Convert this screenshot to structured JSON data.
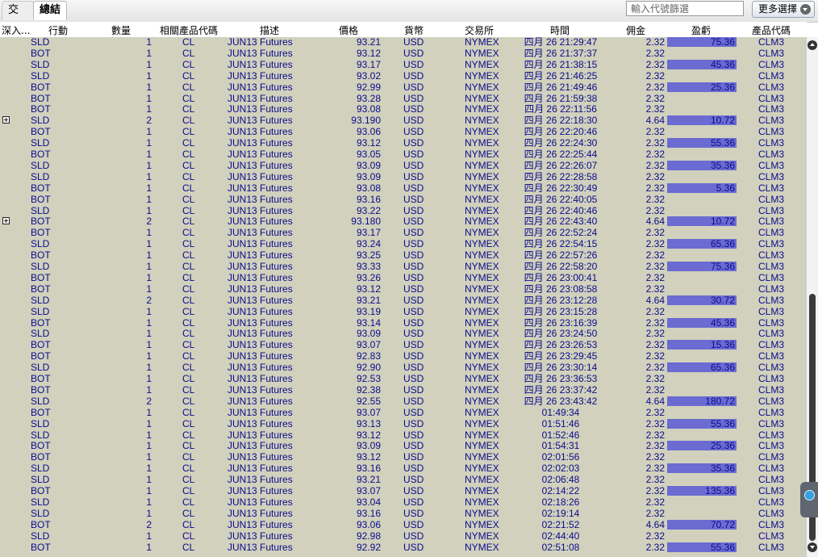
{
  "tabs": [
    "交易",
    "總結"
  ],
  "filter": {
    "placeholder": "輸入代號篩選"
  },
  "more_button": {
    "label": "更多選擇"
  },
  "columns": [
    "深入...",
    "行動",
    "數量",
    "相關產品代碼",
    "描述",
    "價格",
    "貨幣",
    "交易所",
    "時間",
    "佣金",
    "盈虧",
    "產品代碼"
  ],
  "colors": {
    "grid_background": "#d1d1bd",
    "row_text": "#0b0b8c",
    "pnl_bar": "#6b6bd2"
  },
  "rows": [
    {
      "expand": false,
      "action": "SLD",
      "qty": "1",
      "underlying": "CL",
      "desc": "JUN13 Futures",
      "price": "93.21",
      "currency": "USD",
      "exchange": "NYMEX",
      "time": "四月 26 21:29:47",
      "commission": "2.32",
      "pnl": "75.36",
      "symbol": "CLM3"
    },
    {
      "expand": false,
      "action": "BOT",
      "qty": "1",
      "underlying": "CL",
      "desc": "JUN13 Futures",
      "price": "93.12",
      "currency": "USD",
      "exchange": "NYMEX",
      "time": "四月 26 21:37:37",
      "commission": "2.32",
      "pnl": "",
      "symbol": "CLM3"
    },
    {
      "expand": false,
      "action": "SLD",
      "qty": "1",
      "underlying": "CL",
      "desc": "JUN13 Futures",
      "price": "93.17",
      "currency": "USD",
      "exchange": "NYMEX",
      "time": "四月 26 21:38:15",
      "commission": "2.32",
      "pnl": "45.36",
      "symbol": "CLM3"
    },
    {
      "expand": false,
      "action": "SLD",
      "qty": "1",
      "underlying": "CL",
      "desc": "JUN13 Futures",
      "price": "93.02",
      "currency": "USD",
      "exchange": "NYMEX",
      "time": "四月 26 21:46:25",
      "commission": "2.32",
      "pnl": "",
      "symbol": "CLM3"
    },
    {
      "expand": false,
      "action": "BOT",
      "qty": "1",
      "underlying": "CL",
      "desc": "JUN13 Futures",
      "price": "92.99",
      "currency": "USD",
      "exchange": "NYMEX",
      "time": "四月 26 21:49:46",
      "commission": "2.32",
      "pnl": "25.36",
      "symbol": "CLM3"
    },
    {
      "expand": false,
      "action": "BOT",
      "qty": "1",
      "underlying": "CL",
      "desc": "JUN13 Futures",
      "price": "93.28",
      "currency": "USD",
      "exchange": "NYMEX",
      "time": "四月 26 21:59:38",
      "commission": "2.32",
      "pnl": "",
      "symbol": "CLM3"
    },
    {
      "expand": false,
      "action": "BOT",
      "qty": "1",
      "underlying": "CL",
      "desc": "JUN13 Futures",
      "price": "93.08",
      "currency": "USD",
      "exchange": "NYMEX",
      "time": "四月 26 22:11:56",
      "commission": "2.32",
      "pnl": "",
      "symbol": "CLM3"
    },
    {
      "expand": true,
      "action": "SLD",
      "qty": "2",
      "underlying": "CL",
      "desc": "JUN13 Futures",
      "price": "93.190",
      "currency": "USD",
      "exchange": "NYMEX",
      "time": "四月 26 22:18:30",
      "commission": "4.64",
      "pnl": "10.72",
      "symbol": "CLM3"
    },
    {
      "expand": false,
      "action": "BOT",
      "qty": "1",
      "underlying": "CL",
      "desc": "JUN13 Futures",
      "price": "93.06",
      "currency": "USD",
      "exchange": "NYMEX",
      "time": "四月 26 22:20:46",
      "commission": "2.32",
      "pnl": "",
      "symbol": "CLM3"
    },
    {
      "expand": false,
      "action": "SLD",
      "qty": "1",
      "underlying": "CL",
      "desc": "JUN13 Futures",
      "price": "93.12",
      "currency": "USD",
      "exchange": "NYMEX",
      "time": "四月 26 22:24:30",
      "commission": "2.32",
      "pnl": "55.36",
      "symbol": "CLM3"
    },
    {
      "expand": false,
      "action": "BOT",
      "qty": "1",
      "underlying": "CL",
      "desc": "JUN13 Futures",
      "price": "93.05",
      "currency": "USD",
      "exchange": "NYMEX",
      "time": "四月 26 22:25:44",
      "commission": "2.32",
      "pnl": "",
      "symbol": "CLM3"
    },
    {
      "expand": false,
      "action": "SLD",
      "qty": "1",
      "underlying": "CL",
      "desc": "JUN13 Futures",
      "price": "93.09",
      "currency": "USD",
      "exchange": "NYMEX",
      "time": "四月 26 22:26:07",
      "commission": "2.32",
      "pnl": "35.36",
      "symbol": "CLM3"
    },
    {
      "expand": false,
      "action": "SLD",
      "qty": "1",
      "underlying": "CL",
      "desc": "JUN13 Futures",
      "price": "93.09",
      "currency": "USD",
      "exchange": "NYMEX",
      "time": "四月 26 22:28:58",
      "commission": "2.32",
      "pnl": "",
      "symbol": "CLM3"
    },
    {
      "expand": false,
      "action": "BOT",
      "qty": "1",
      "underlying": "CL",
      "desc": "JUN13 Futures",
      "price": "93.08",
      "currency": "USD",
      "exchange": "NYMEX",
      "time": "四月 26 22:30:49",
      "commission": "2.32",
      "pnl": "5.36",
      "symbol": "CLM3"
    },
    {
      "expand": false,
      "action": "BOT",
      "qty": "1",
      "underlying": "CL",
      "desc": "JUN13 Futures",
      "price": "93.16",
      "currency": "USD",
      "exchange": "NYMEX",
      "time": "四月 26 22:40:05",
      "commission": "2.32",
      "pnl": "",
      "symbol": "CLM3"
    },
    {
      "expand": false,
      "action": "SLD",
      "qty": "1",
      "underlying": "CL",
      "desc": "JUN13 Futures",
      "price": "93.22",
      "currency": "USD",
      "exchange": "NYMEX",
      "time": "四月 26 22:40:46",
      "commission": "2.32",
      "pnl": "",
      "symbol": "CLM3"
    },
    {
      "expand": true,
      "action": "BOT",
      "qty": "2",
      "underlying": "CL",
      "desc": "JUN13 Futures",
      "price": "93.180",
      "currency": "USD",
      "exchange": "NYMEX",
      "time": "四月 26 22:43:40",
      "commission": "4.64",
      "pnl": "10.72",
      "symbol": "CLM3"
    },
    {
      "expand": false,
      "action": "BOT",
      "qty": "1",
      "underlying": "CL",
      "desc": "JUN13 Futures",
      "price": "93.17",
      "currency": "USD",
      "exchange": "NYMEX",
      "time": "四月 26 22:52:24",
      "commission": "2.32",
      "pnl": "",
      "symbol": "CLM3"
    },
    {
      "expand": false,
      "action": "SLD",
      "qty": "1",
      "underlying": "CL",
      "desc": "JUN13 Futures",
      "price": "93.24",
      "currency": "USD",
      "exchange": "NYMEX",
      "time": "四月 26 22:54:15",
      "commission": "2.32",
      "pnl": "65.36",
      "symbol": "CLM3"
    },
    {
      "expand": false,
      "action": "BOT",
      "qty": "1",
      "underlying": "CL",
      "desc": "JUN13 Futures",
      "price": "93.25",
      "currency": "USD",
      "exchange": "NYMEX",
      "time": "四月 26 22:57:26",
      "commission": "2.32",
      "pnl": "",
      "symbol": "CLM3"
    },
    {
      "expand": false,
      "action": "SLD",
      "qty": "1",
      "underlying": "CL",
      "desc": "JUN13 Futures",
      "price": "93.33",
      "currency": "USD",
      "exchange": "NYMEX",
      "time": "四月 26 22:58:20",
      "commission": "2.32",
      "pnl": "75.36",
      "symbol": "CLM3"
    },
    {
      "expand": false,
      "action": "BOT",
      "qty": "1",
      "underlying": "CL",
      "desc": "JUN13 Futures",
      "price": "93.26",
      "currency": "USD",
      "exchange": "NYMEX",
      "time": "四月 26 23:00:41",
      "commission": "2.32",
      "pnl": "",
      "symbol": "CLM3"
    },
    {
      "expand": false,
      "action": "BOT",
      "qty": "1",
      "underlying": "CL",
      "desc": "JUN13 Futures",
      "price": "93.12",
      "currency": "USD",
      "exchange": "NYMEX",
      "time": "四月 26 23:08:58",
      "commission": "2.32",
      "pnl": "",
      "symbol": "CLM3"
    },
    {
      "expand": false,
      "action": "SLD",
      "qty": "2",
      "underlying": "CL",
      "desc": "JUN13 Futures",
      "price": "93.21",
      "currency": "USD",
      "exchange": "NYMEX",
      "time": "四月 26 23:12:28",
      "commission": "4.64",
      "pnl": "30.72",
      "symbol": "CLM3"
    },
    {
      "expand": false,
      "action": "SLD",
      "qty": "1",
      "underlying": "CL",
      "desc": "JUN13 Futures",
      "price": "93.19",
      "currency": "USD",
      "exchange": "NYMEX",
      "time": "四月 26 23:15:28",
      "commission": "2.32",
      "pnl": "",
      "symbol": "CLM3"
    },
    {
      "expand": false,
      "action": "BOT",
      "qty": "1",
      "underlying": "CL",
      "desc": "JUN13 Futures",
      "price": "93.14",
      "currency": "USD",
      "exchange": "NYMEX",
      "time": "四月 26 23:16:39",
      "commission": "2.32",
      "pnl": "45.36",
      "symbol": "CLM3"
    },
    {
      "expand": false,
      "action": "SLD",
      "qty": "1",
      "underlying": "CL",
      "desc": "JUN13 Futures",
      "price": "93.09",
      "currency": "USD",
      "exchange": "NYMEX",
      "time": "四月 26 23:24:50",
      "commission": "2.32",
      "pnl": "",
      "symbol": "CLM3"
    },
    {
      "expand": false,
      "action": "BOT",
      "qty": "1",
      "underlying": "CL",
      "desc": "JUN13 Futures",
      "price": "93.07",
      "currency": "USD",
      "exchange": "NYMEX",
      "time": "四月 26 23:26:53",
      "commission": "2.32",
      "pnl": "15.36",
      "symbol": "CLM3"
    },
    {
      "expand": false,
      "action": "BOT",
      "qty": "1",
      "underlying": "CL",
      "desc": "JUN13 Futures",
      "price": "92.83",
      "currency": "USD",
      "exchange": "NYMEX",
      "time": "四月 26 23:29:45",
      "commission": "2.32",
      "pnl": "",
      "symbol": "CLM3"
    },
    {
      "expand": false,
      "action": "SLD",
      "qty": "1",
      "underlying": "CL",
      "desc": "JUN13 Futures",
      "price": "92.90",
      "currency": "USD",
      "exchange": "NYMEX",
      "time": "四月 26 23:30:14",
      "commission": "2.32",
      "pnl": "65.36",
      "symbol": "CLM3"
    },
    {
      "expand": false,
      "action": "BOT",
      "qty": "1",
      "underlying": "CL",
      "desc": "JUN13 Futures",
      "price": "92.53",
      "currency": "USD",
      "exchange": "NYMEX",
      "time": "四月 26 23:36:53",
      "commission": "2.32",
      "pnl": "",
      "symbol": "CLM3"
    },
    {
      "expand": false,
      "action": "BOT",
      "qty": "1",
      "underlying": "CL",
      "desc": "JUN13 Futures",
      "price": "92.38",
      "currency": "USD",
      "exchange": "NYMEX",
      "time": "四月 26 23:37:42",
      "commission": "2.32",
      "pnl": "",
      "symbol": "CLM3"
    },
    {
      "expand": false,
      "action": "SLD",
      "qty": "2",
      "underlying": "CL",
      "desc": "JUN13 Futures",
      "price": "92.55",
      "currency": "USD",
      "exchange": "NYMEX",
      "time": "四月 26 23:43:42",
      "commission": "4.64",
      "pnl": "180.72",
      "symbol": "CLM3"
    },
    {
      "expand": false,
      "action": "BOT",
      "qty": "1",
      "underlying": "CL",
      "desc": "JUN13 Futures",
      "price": "93.07",
      "currency": "USD",
      "exchange": "NYMEX",
      "time": "01:49:34",
      "commission": "2.32",
      "pnl": "",
      "symbol": "CLM3"
    },
    {
      "expand": false,
      "action": "SLD",
      "qty": "1",
      "underlying": "CL",
      "desc": "JUN13 Futures",
      "price": "93.13",
      "currency": "USD",
      "exchange": "NYMEX",
      "time": "01:51:46",
      "commission": "2.32",
      "pnl": "55.36",
      "symbol": "CLM3"
    },
    {
      "expand": false,
      "action": "SLD",
      "qty": "1",
      "underlying": "CL",
      "desc": "JUN13 Futures",
      "price": "93.12",
      "currency": "USD",
      "exchange": "NYMEX",
      "time": "01:52:46",
      "commission": "2.32",
      "pnl": "",
      "symbol": "CLM3"
    },
    {
      "expand": false,
      "action": "BOT",
      "qty": "1",
      "underlying": "CL",
      "desc": "JUN13 Futures",
      "price": "93.09",
      "currency": "USD",
      "exchange": "NYMEX",
      "time": "01:54:31",
      "commission": "2.32",
      "pnl": "25.36",
      "symbol": "CLM3"
    },
    {
      "expand": false,
      "action": "BOT",
      "qty": "1",
      "underlying": "CL",
      "desc": "JUN13 Futures",
      "price": "93.12",
      "currency": "USD",
      "exchange": "NYMEX",
      "time": "02:01:56",
      "commission": "2.32",
      "pnl": "",
      "symbol": "CLM3"
    },
    {
      "expand": false,
      "action": "SLD",
      "qty": "1",
      "underlying": "CL",
      "desc": "JUN13 Futures",
      "price": "93.16",
      "currency": "USD",
      "exchange": "NYMEX",
      "time": "02:02:03",
      "commission": "2.32",
      "pnl": "35.36",
      "symbol": "CLM3"
    },
    {
      "expand": false,
      "action": "SLD",
      "qty": "1",
      "underlying": "CL",
      "desc": "JUN13 Futures",
      "price": "93.21",
      "currency": "USD",
      "exchange": "NYMEX",
      "time": "02:06:48",
      "commission": "2.32",
      "pnl": "",
      "symbol": "CLM3"
    },
    {
      "expand": false,
      "action": "BOT",
      "qty": "1",
      "underlying": "CL",
      "desc": "JUN13 Futures",
      "price": "93.07",
      "currency": "USD",
      "exchange": "NYMEX",
      "time": "02:14:22",
      "commission": "2.32",
      "pnl": "135.36",
      "symbol": "CLM3"
    },
    {
      "expand": false,
      "action": "SLD",
      "qty": "1",
      "underlying": "CL",
      "desc": "JUN13 Futures",
      "price": "93.04",
      "currency": "USD",
      "exchange": "NYMEX",
      "time": "02:18:26",
      "commission": "2.32",
      "pnl": "",
      "symbol": "CLM3"
    },
    {
      "expand": false,
      "action": "SLD",
      "qty": "1",
      "underlying": "CL",
      "desc": "JUN13 Futures",
      "price": "93.16",
      "currency": "USD",
      "exchange": "NYMEX",
      "time": "02:19:14",
      "commission": "2.32",
      "pnl": "",
      "symbol": "CLM3"
    },
    {
      "expand": false,
      "action": "BOT",
      "qty": "2",
      "underlying": "CL",
      "desc": "JUN13 Futures",
      "price": "93.06",
      "currency": "USD",
      "exchange": "NYMEX",
      "time": "02:21:52",
      "commission": "4.64",
      "pnl": "70.72",
      "symbol": "CLM3"
    },
    {
      "expand": false,
      "action": "SLD",
      "qty": "1",
      "underlying": "CL",
      "desc": "JUN13 Futures",
      "price": "92.98",
      "currency": "USD",
      "exchange": "NYMEX",
      "time": "02:44:40",
      "commission": "2.32",
      "pnl": "",
      "symbol": "CLM3"
    },
    {
      "expand": false,
      "action": "BOT",
      "qty": "1",
      "underlying": "CL",
      "desc": "JUN13 Futures",
      "price": "92.92",
      "currency": "USD",
      "exchange": "NYMEX",
      "time": "02:51:08",
      "commission": "2.32",
      "pnl": "55.36",
      "symbol": "CLM3"
    }
  ]
}
